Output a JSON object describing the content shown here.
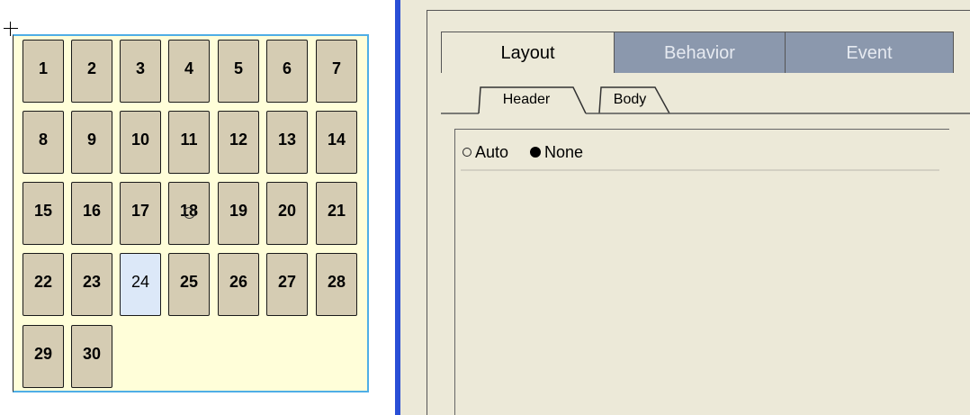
{
  "calendar": {
    "days": [
      "1",
      "2",
      "3",
      "4",
      "5",
      "6",
      "7",
      "8",
      "9",
      "10",
      "11",
      "12",
      "13",
      "14",
      "15",
      "16",
      "17",
      "18",
      "19",
      "20",
      "21",
      "22",
      "23",
      "24",
      "25",
      "26",
      "27",
      "28",
      "29",
      "30"
    ],
    "selected_day": "24"
  },
  "properties": {
    "main_tabs": [
      {
        "label": "Layout",
        "active": true
      },
      {
        "label": "Behavior",
        "active": false
      },
      {
        "label": "Event",
        "active": false
      }
    ],
    "sub_tabs": [
      {
        "label": "Header",
        "active": true
      },
      {
        "label": "Body",
        "active": false
      }
    ],
    "radio_options": [
      {
        "label": "Auto",
        "checked": false
      },
      {
        "label": "None",
        "checked": true
      }
    ]
  },
  "colors": {
    "cell_bg": "#d5ccb3",
    "selected_cell_bg": "#dce8f8",
    "calendar_bg": "#fffed9",
    "inactive_tab_bg": "#8b98ad",
    "panel_bg": "#ece9d8",
    "separator": "#2a4fd6"
  }
}
